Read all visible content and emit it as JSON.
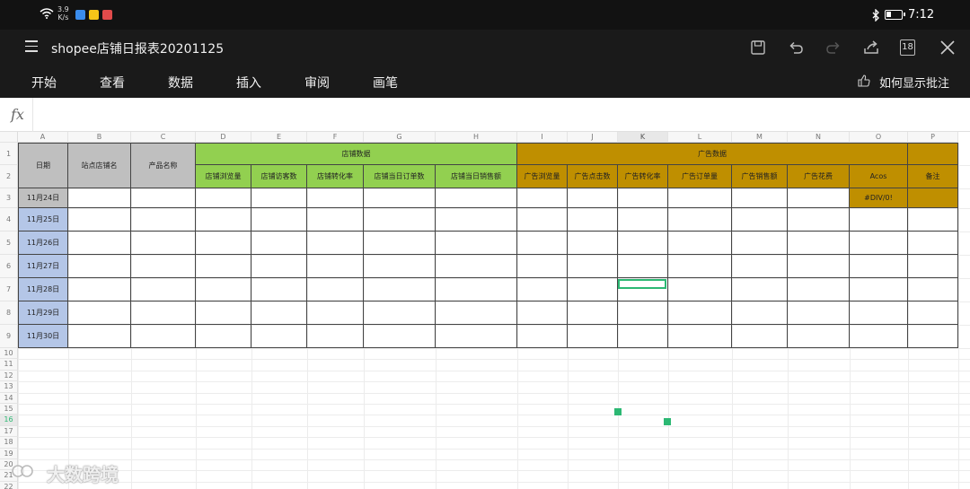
{
  "status_bar": {
    "net_speed_value": "3.9",
    "net_speed_unit": "K/s",
    "time": "7:12",
    "app_icon_colors": [
      "#3b8ded",
      "#f5c518",
      "#e14b4b"
    ]
  },
  "title_bar": {
    "doc_title": "shopee店铺日报表20201125",
    "tab_count": "18",
    "icons": [
      "menu-icon",
      "save-icon",
      "undo-icon",
      "redo-icon",
      "share-icon",
      "tabs-icon",
      "close-icon"
    ]
  },
  "ribbon": {
    "tabs": [
      "开始",
      "查看",
      "数据",
      "插入",
      "审阅",
      "画笔"
    ],
    "help_link": "如何显示批注"
  },
  "formula_bar": {
    "fx_label": "fx",
    "value": ""
  },
  "sheet": {
    "columns": [
      "A",
      "B",
      "C",
      "D",
      "E",
      "F",
      "G",
      "H",
      "I",
      "J",
      "K",
      "L",
      "M",
      "N",
      "O",
      "P"
    ],
    "selected_column": "K",
    "selected_row": "16",
    "rows": [
      "1",
      "2",
      "3",
      "4",
      "5",
      "6",
      "7",
      "8",
      "9",
      "10",
      "11",
      "12",
      "13",
      "14",
      "15",
      "16",
      "17",
      "18",
      "19",
      "20",
      "21",
      "22"
    ],
    "headers": {
      "date": "日期",
      "site_store": "站点店铺名",
      "product": "产品名称",
      "store_group": "店铺数据",
      "store_views": "店铺浏览量",
      "store_visitors": "店铺访客数",
      "store_conversion": "店铺转化率",
      "store_orders": "店铺当日订单数",
      "store_sales": "店铺当日销售额",
      "ad_group": "广告数据",
      "ad_views": "广告浏览量",
      "ad_clicks": "广告点击数",
      "ad_conversion": "广告转化率",
      "ad_orders": "广告订单量",
      "ad_sales": "广告销售额",
      "ad_spend": "广告花费",
      "acos": "Acos",
      "notes": "备注"
    },
    "dates": [
      "11月24日",
      "11月25日",
      "11月26日",
      "11月27日",
      "11月28日",
      "11月29日",
      "11月30日"
    ],
    "acos_row3": "#DIV/0!",
    "colors": {
      "green_header": "#92d050",
      "gold_header": "#bf8f00",
      "gray_header": "#bfbfbf",
      "date_blue": "#b4c6e7",
      "selection": "#2cb873"
    }
  },
  "watermark": "大数跨境"
}
